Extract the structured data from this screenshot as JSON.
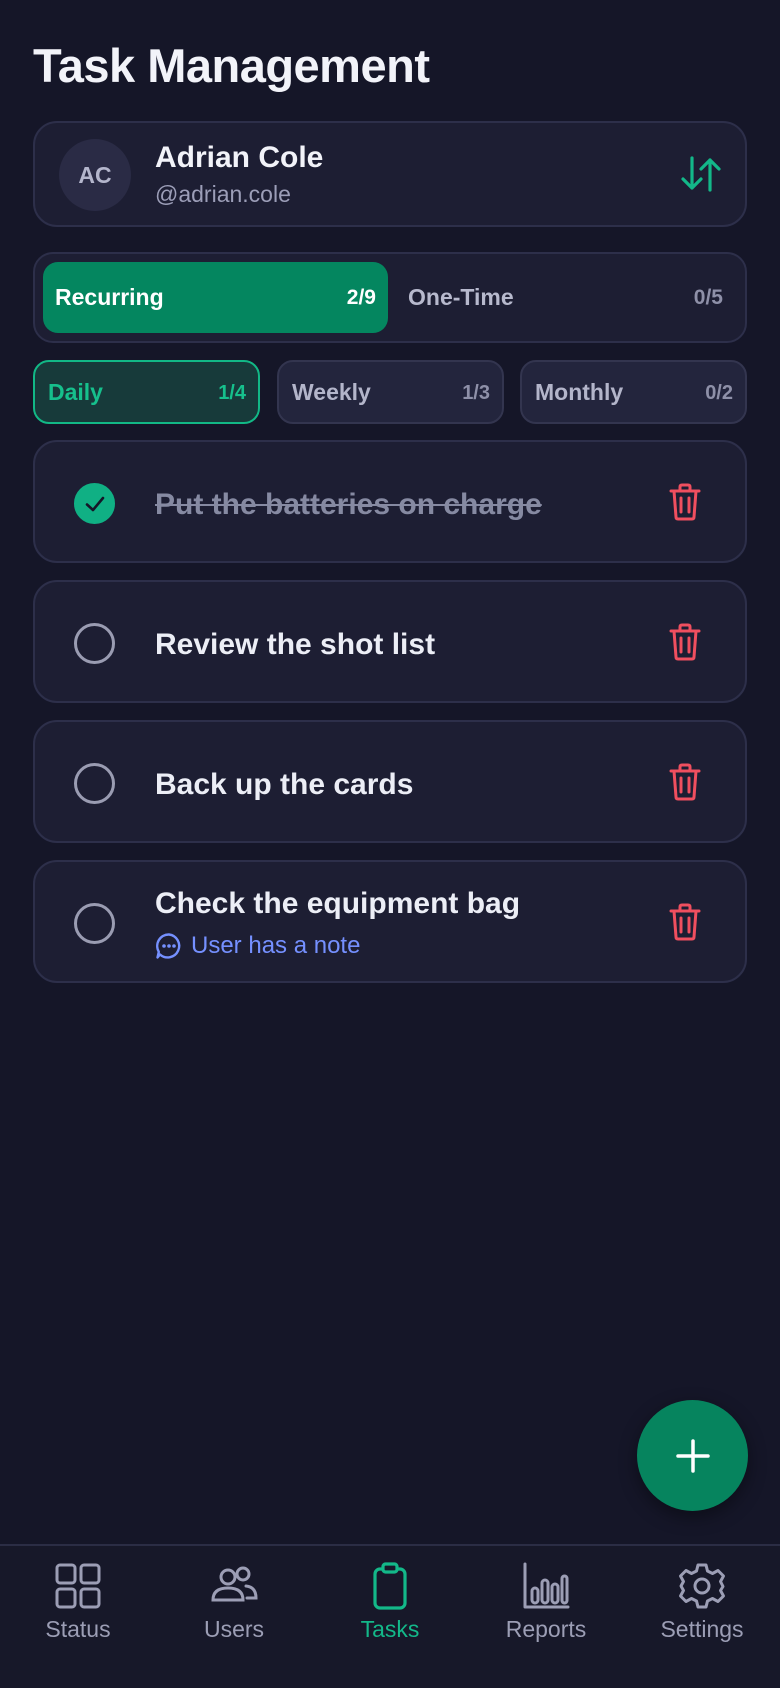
{
  "page": {
    "title": "Task Management"
  },
  "user": {
    "initials": "AC",
    "name": "Adrian Cole",
    "handle": "@adrian.cole",
    "switch_icon": "swap-vertical-icon"
  },
  "task_types": [
    {
      "label": "Recurring",
      "count": "2/9",
      "active": true
    },
    {
      "label": "One-Time",
      "count": "0/5",
      "active": false
    }
  ],
  "frequency_tabs": [
    {
      "label": "Daily",
      "count": "1/4",
      "active": true
    },
    {
      "label": "Weekly",
      "count": "1/3",
      "active": false
    },
    {
      "label": "Monthly",
      "count": "0/2",
      "active": false
    }
  ],
  "tasks": [
    {
      "title": "Put the batteries on charge",
      "done": true,
      "note": null
    },
    {
      "title": "Review the shot list",
      "done": false,
      "note": null
    },
    {
      "title": "Back up the cards",
      "done": false,
      "note": null
    },
    {
      "title": "Check the equipment bag",
      "done": false,
      "note": "User has a note"
    }
  ],
  "fab": {
    "icon": "plus-icon"
  },
  "nav": [
    {
      "label": "Status",
      "icon": "grid-icon",
      "active": false
    },
    {
      "label": "Users",
      "icon": "users-icon",
      "active": false
    },
    {
      "label": "Tasks",
      "icon": "clipboard-icon",
      "active": true
    },
    {
      "label": "Reports",
      "icon": "bar-chart-icon",
      "active": false
    },
    {
      "label": "Settings",
      "icon": "gear-icon",
      "active": false
    }
  ],
  "colors": {
    "background": "#151628",
    "card": "#1d1e33",
    "accent": "#04865f",
    "accent_text": "#16c08c",
    "danger": "#f04f5f",
    "note_link": "#7590ff"
  }
}
